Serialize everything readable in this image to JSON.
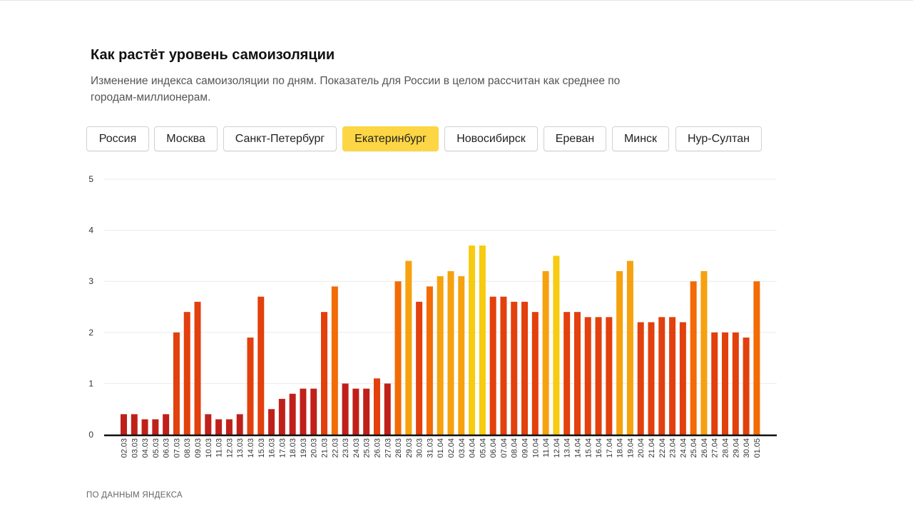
{
  "header": {
    "title": "Как растёт уровень самоизоляции",
    "subtitle": "Изменение индекса самоизоляции по дням. Показатель для России в целом рассчитан как среднее по городам-миллионерам."
  },
  "tabs": [
    {
      "label": "Россия",
      "active": false
    },
    {
      "label": "Москва",
      "active": false
    },
    {
      "label": "Санкт-Петербург",
      "active": false
    },
    {
      "label": "Екатеринбург",
      "active": true
    },
    {
      "label": "Новосибирск",
      "active": false
    },
    {
      "label": "Ереван",
      "active": false
    },
    {
      "label": "Минск",
      "active": false
    },
    {
      "label": "Нур-Султан",
      "active": false
    }
  ],
  "chart_data": {
    "type": "bar",
    "title": "",
    "xlabel": "",
    "ylabel": "",
    "ylim": [
      0,
      5
    ],
    "yticks": [
      0,
      1,
      2,
      3,
      4,
      5
    ],
    "grid": true,
    "categories": [
      "02.03",
      "03.03",
      "04.03",
      "05.03",
      "06.03",
      "07.03",
      "08.03",
      "09.03",
      "10.03",
      "11.03",
      "12.03",
      "13.03",
      "14.03",
      "15.03",
      "16.03",
      "17.03",
      "18.03",
      "19.03",
      "20.03",
      "21.03",
      "22.03",
      "23.03",
      "24.03",
      "25.03",
      "26.03",
      "27.03",
      "28.03",
      "29.03",
      "30.03",
      "31.03",
      "01.04",
      "02.04",
      "03.04",
      "04.04",
      "05.04",
      "06.04",
      "07.04",
      "08.04",
      "09.04",
      "10.04",
      "11.04",
      "12.04",
      "13.04",
      "14.04",
      "15.04",
      "16.04",
      "17.04",
      "18.04",
      "19.04",
      "20.04",
      "21.04",
      "22.04",
      "23.04",
      "24.04",
      "25.04",
      "26.04",
      "27.04",
      "28.04",
      "29.04",
      "30.04",
      "01.05"
    ],
    "values": [
      0.4,
      0.4,
      0.3,
      0.3,
      0.4,
      2.0,
      2.4,
      2.6,
      0.4,
      0.3,
      0.3,
      0.4,
      1.9,
      2.7,
      0.5,
      0.7,
      0.8,
      0.9,
      0.9,
      2.4,
      2.9,
      1.0,
      0.9,
      0.9,
      1.1,
      1.0,
      3.0,
      3.4,
      2.6,
      2.9,
      3.1,
      3.2,
      3.1,
      3.7,
      3.7,
      2.7,
      2.7,
      2.6,
      2.6,
      2.4,
      3.2,
      3.5,
      2.4,
      2.4,
      2.3,
      2.3,
      2.3,
      3.2,
      3.4,
      2.2,
      2.2,
      2.3,
      2.3,
      2.2,
      3.0,
      3.2,
      2.0,
      2.0,
      2.0,
      1.9,
      3.0
    ],
    "color_scale": [
      "#c0201a",
      "#e2400d",
      "#f26b05",
      "#f6a10e",
      "#f6cb10"
    ]
  },
  "footer": {
    "source": "ПО ДАННЫМ ЯНДЕКСА"
  }
}
